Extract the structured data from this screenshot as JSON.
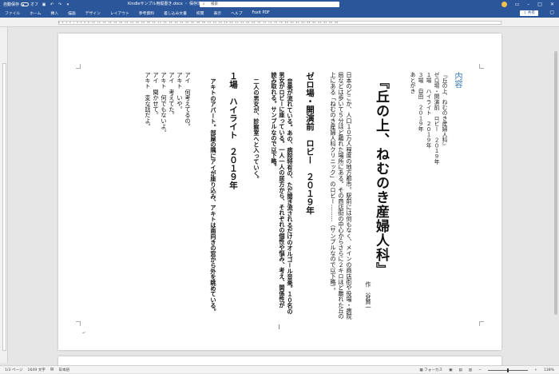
{
  "titlebar": {
    "autosave_label": "自動保存",
    "autosave_state": "オフ",
    "doc_title": "Kindleサンプル用縦書き.docx ・ 保存済み",
    "search_placeholder": "検索"
  },
  "ribbon": {
    "tabs": [
      "ファイル",
      "ホーム",
      "挿入",
      "描画",
      "デザイン",
      "レイアウト",
      "参考資料",
      "差し込み文書",
      "校閲",
      "表示",
      "ヘルプ",
      "Foxit PDF"
    ],
    "share_label": "共有"
  },
  "ruler_ticks": "8 6 4 2 | 2 4 6 8 10 12 14 16 18 20 22 24 26 28 30 32 34 36 38 40 42 44 46 48 50 52 54 56 58 60 62 64 66 68 70 72 74 76 78 80 82 84 86 88 90 92 94 96 98",
  "document": {
    "toc_heading": "内容",
    "toc_entries": [
      "『丘の上、ねむのき産婦人科』",
      "ゼロ場・開演前　ロビー　２０１９年",
      "１場　ハイライト　２０１９年",
      "３場　自由　２０１９年",
      "あとがき"
    ],
    "title": "『丘の上、ねむのき産婦人科』",
    "author": "作　谷賢一",
    "intro_lines": [
      "日本のどこか、人口１０万人程度の地方都市。駅前には何もなく、メインの商店街や役場・病院",
      "局などは歩いて５分ほど離れた場所にある。その商店街の中心からさらに２キロほど離れた丘の",
      "上にある「ねむのき産婦人科クリニック」のロビー………（サンプルなので以下略）。"
    ],
    "scene0_heading": "ゼロ場・開演前　ロビー　２０１９年",
    "scene0_lines": [
      "音楽が流れている。あの、病院特有の、ただ聞き流されるだけのオルゴール音楽。１０名の",
      "男女がロビーに座っている。一人一人の居方から、それぞれの個性や悩み、考え、関係性が",
      "読み取れる。サンプルなので以下略。",
      "二人の男女が、診察室へと入っていく。"
    ],
    "scene1_heading": "１場　ハイライト　２０１９年",
    "scene1_direction": "アキトのアパート。部屋の隅にアイが座り込み、アキトは南向きの窓から外を眺めている。",
    "dialogue": [
      {
        "speaker": "アイ",
        "line": "何考えてるの。"
      },
      {
        "speaker": "アキト",
        "line": "いや。"
      },
      {
        "speaker": "アイ",
        "line": "考えてた。"
      },
      {
        "speaker": "アキト",
        "line": "何でもないよ。"
      },
      {
        "speaker": "アイ",
        "line": "聞かせて。"
      },
      {
        "speaker": "アキト",
        "line": "変な話だよ。"
      }
    ]
  },
  "statusbar": {
    "page": "1/3 ページ",
    "words": "1649 文字",
    "language": "日本語",
    "focus": "フォーカス",
    "zoom": "138%"
  }
}
